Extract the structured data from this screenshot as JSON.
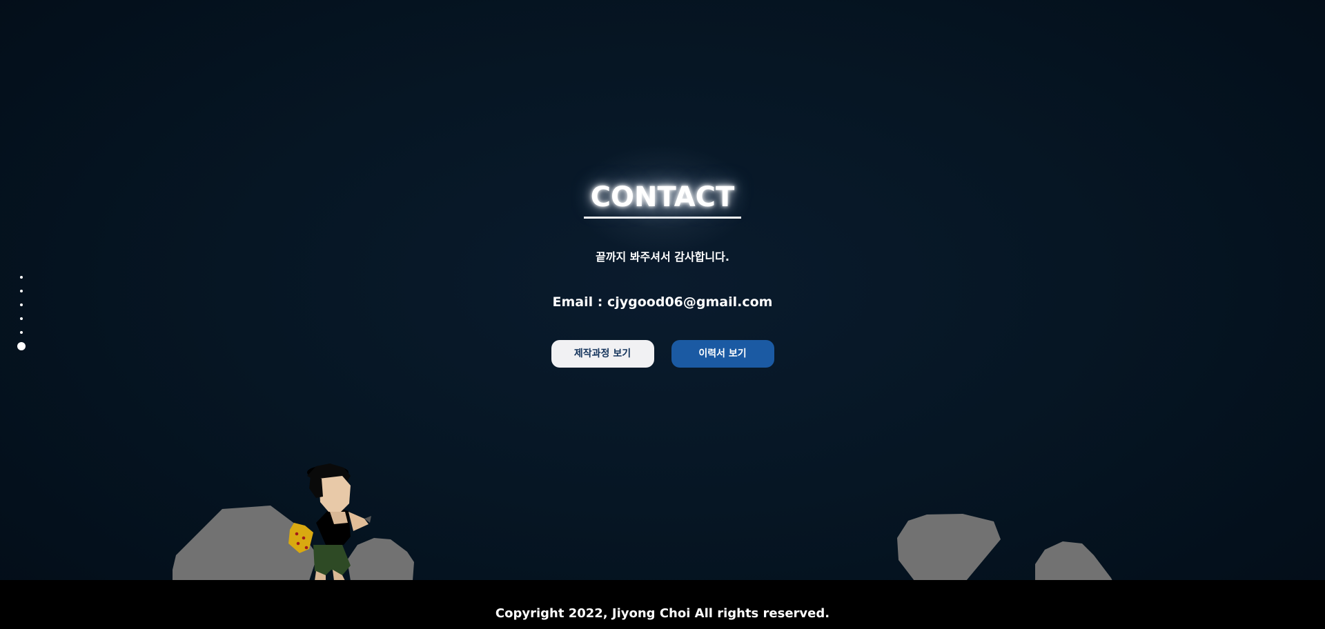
{
  "contact": {
    "title": "CONTACT",
    "thanks": "끝까지 봐주셔서 감사합니다.",
    "email": "Email : cjygood06@gmail.com"
  },
  "buttons": {
    "process_label": "제작과정 보기",
    "resume_label": "이력서 보기"
  },
  "navigation": {
    "dot_count": 6,
    "active_index": 5
  },
  "footer": {
    "copyright": "Copyright 2022, Jiyong Choi All rights reserved."
  },
  "colors": {
    "background": "#041220",
    "process_button": "#f1f1f3",
    "resume_button": "#1b5aa3",
    "rock": "#727272",
    "footer": "#000000"
  }
}
